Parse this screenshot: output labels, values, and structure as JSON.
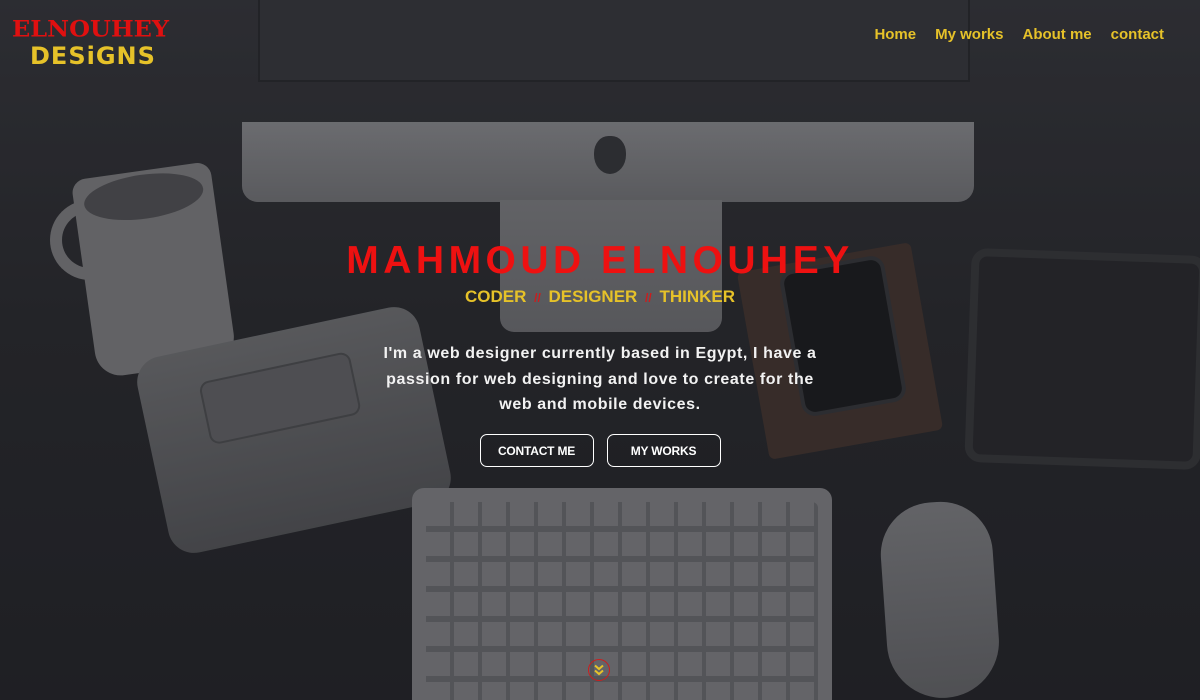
{
  "brand": {
    "logo_line1": "ELNOUHEY",
    "logo_line2": "DESiGNS",
    "colors": {
      "red": "#ee1111",
      "gold": "#e6c229",
      "white": "#ffffff"
    }
  },
  "nav": {
    "items": [
      {
        "label": "Home"
      },
      {
        "label": "My works"
      },
      {
        "label": "About me"
      },
      {
        "label": "contact"
      }
    ]
  },
  "hero": {
    "name": "MAHMOUD ELNOUHEY",
    "tagline": {
      "part1": "CODER",
      "part2": "DESIGNER",
      "part3": "THINKER",
      "separator": "//"
    },
    "bio": "I'm a web designer currently based in Egypt, I have a passion for web designing and love to create for the web and mobile devices.",
    "buttons": {
      "contact_label": "CONTACT ME",
      "works_label": "MY WORKS"
    }
  },
  "icons": {
    "scroll": "chevron-double-down-icon"
  }
}
